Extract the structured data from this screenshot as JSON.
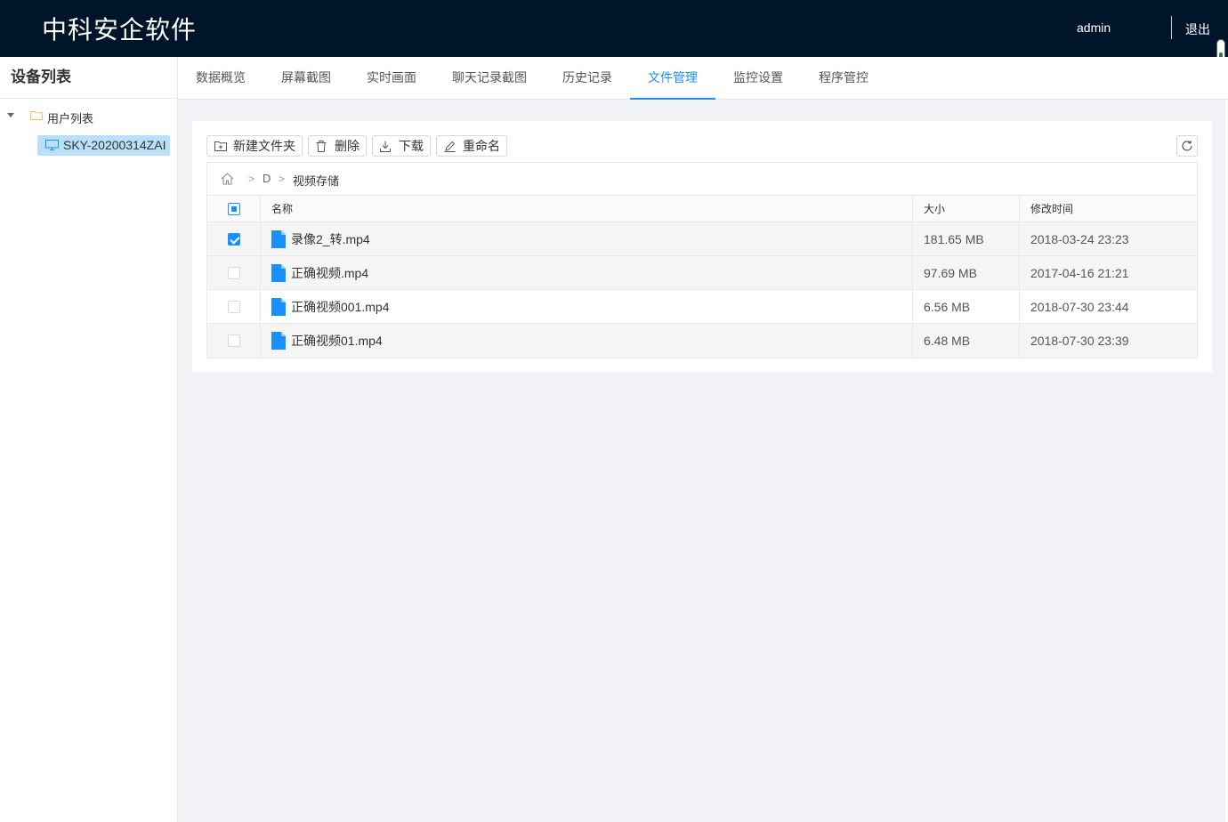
{
  "header": {
    "app_title": "中科安企软件",
    "user": "admin",
    "logout_label": "退出"
  },
  "sidebar": {
    "title": "设备列表",
    "tree": {
      "root_label": "用户列表",
      "nodes": [
        {
          "label": "SKY-20200314ZAI",
          "selected": true
        }
      ]
    }
  },
  "tabs": [
    {
      "label": "数据概览",
      "active": false
    },
    {
      "label": "屏幕截图",
      "active": false
    },
    {
      "label": "实时画面",
      "active": false
    },
    {
      "label": "聊天记录截图",
      "active": false
    },
    {
      "label": "历史记录",
      "active": false
    },
    {
      "label": "文件管理",
      "active": true
    },
    {
      "label": "监控设置",
      "active": false
    },
    {
      "label": "程序管控",
      "active": false
    }
  ],
  "toolbar": {
    "new_folder_label": "新建文件夹",
    "delete_label": "删除",
    "download_label": "下载",
    "rename_label": "重命名"
  },
  "breadcrumb": {
    "items": [
      "D",
      "视频存储"
    ]
  },
  "table": {
    "columns": {
      "name": "名称",
      "size": "大小",
      "modified": "修改时间"
    },
    "rows": [
      {
        "name": "录像2_转.mp4",
        "size": "181.65 MB",
        "modified": "2018-03-24 23:23",
        "checked": true
      },
      {
        "name": "正确视频.mp4",
        "size": "97.69 MB",
        "modified": "2017-04-16 21:21",
        "checked": false
      },
      {
        "name": "正确视频001.mp4",
        "size": "6.56 MB",
        "modified": "2018-07-30 23:44",
        "checked": false
      },
      {
        "name": "正确视频01.mp4",
        "size": "6.48 MB",
        "modified": "2018-07-30 23:39",
        "checked": false
      }
    ]
  },
  "colors": {
    "header_bg": "#001529",
    "accent": "#1890ff",
    "selected_node_bg": "#bae0f7",
    "folder_icon": "#f5c242",
    "file_icon": "#1890ff"
  }
}
